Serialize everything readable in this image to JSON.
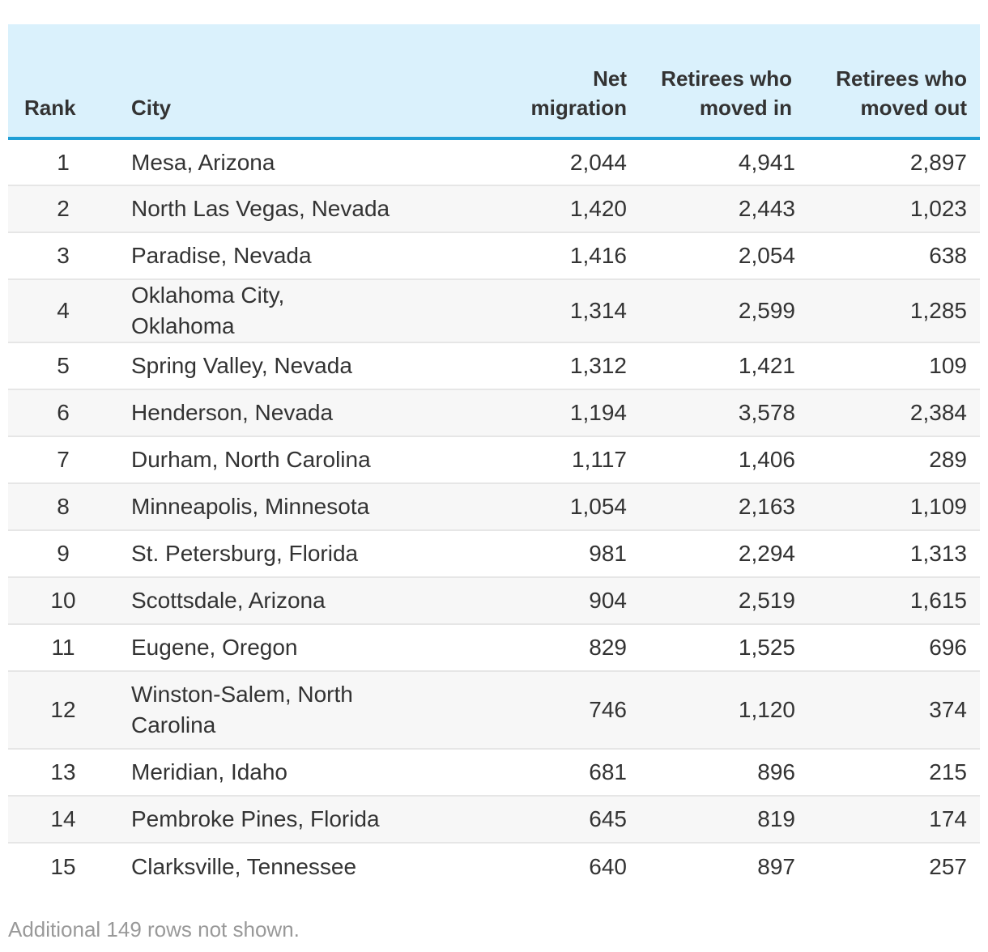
{
  "chart_data": {
    "type": "table",
    "columns": [
      "Rank",
      "City",
      "Net migration",
      "Retirees who moved in",
      "Retirees who moved out"
    ],
    "rows": [
      {
        "rank": "1",
        "city": "Mesa, Arizona",
        "net": "2,044",
        "moved_in": "4,941",
        "moved_out": "2,897"
      },
      {
        "rank": "2",
        "city": "North Las Vegas, Nevada",
        "net": "1,420",
        "moved_in": "2,443",
        "moved_out": "1,023"
      },
      {
        "rank": "3",
        "city": "Paradise, Nevada",
        "net": "1,416",
        "moved_in": "2,054",
        "moved_out": "638"
      },
      {
        "rank": "4",
        "city": "Oklahoma City, Oklahoma",
        "net": "1,314",
        "moved_in": "2,599",
        "moved_out": "1,285"
      },
      {
        "rank": "5",
        "city": "Spring Valley, Nevada",
        "net": "1,312",
        "moved_in": "1,421",
        "moved_out": "109"
      },
      {
        "rank": "6",
        "city": "Henderson, Nevada",
        "net": "1,194",
        "moved_in": "3,578",
        "moved_out": "2,384"
      },
      {
        "rank": "7",
        "city": "Durham, North Carolina",
        "net": "1,117",
        "moved_in": "1,406",
        "moved_out": "289"
      },
      {
        "rank": "8",
        "city": "Minneapolis, Minnesota",
        "net": "1,054",
        "moved_in": "2,163",
        "moved_out": "1,109"
      },
      {
        "rank": "9",
        "city": "St. Petersburg, Florida",
        "net": "981",
        "moved_in": "2,294",
        "moved_out": "1,313"
      },
      {
        "rank": "10",
        "city": "Scottsdale, Arizona",
        "net": "904",
        "moved_in": "2,519",
        "moved_out": "1,615"
      },
      {
        "rank": "11",
        "city": "Eugene, Oregon",
        "net": "829",
        "moved_in": "1,525",
        "moved_out": "696"
      },
      {
        "rank": "12",
        "city": "Winston-Salem, North Carolina",
        "net": "746",
        "moved_in": "1,120",
        "moved_out": "374"
      },
      {
        "rank": "13",
        "city": "Meridian, Idaho",
        "net": "681",
        "moved_in": "896",
        "moved_out": "215"
      },
      {
        "rank": "14",
        "city": "Pembroke Pines, Florida",
        "net": "645",
        "moved_in": "819",
        "moved_out": "174"
      },
      {
        "rank": "15",
        "city": "Clarksville, Tennessee",
        "net": "640",
        "moved_in": "897",
        "moved_out": "257"
      }
    ],
    "footer": "Additional 149 rows not shown.",
    "colors": {
      "header_background": "#daf1fc",
      "header_rule": "#1f9fd6",
      "stripe": "#f7f7f7",
      "row_divider": "#e6e6e6",
      "footer_text": "#999999"
    }
  }
}
